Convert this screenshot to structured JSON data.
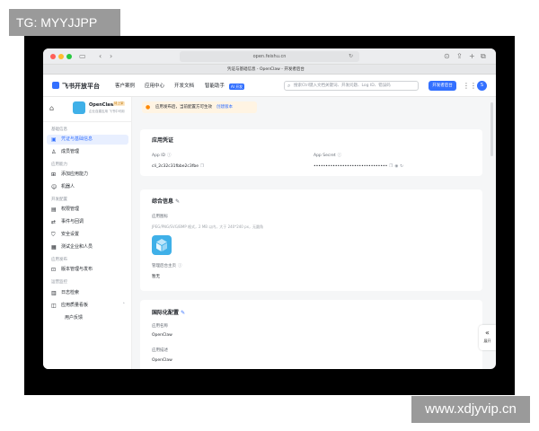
{
  "watermark_top": "TG: MYYJJPP",
  "watermark_bottom": "www.xdjyvip.cn",
  "browser": {
    "url": "open.feishu.cn",
    "tab_title": "凭证与基础信息 - OpenClaw - 开发者后台"
  },
  "nav": {
    "logo": "飞书开放平台",
    "items": [
      "客户案例",
      "应用中心",
      "开发文档",
      "智能助手"
    ],
    "ai_tag": "AI 开发",
    "search_placeholder": "搜索Ctrl键入文档关键词、开发问题、Log ID、错误码",
    "dev_console": "开发者后台",
    "avatar": "S"
  },
  "app": {
    "name": "OpenClaw",
    "tag": "待上架",
    "desc": "企业自建应用 飞书中可用"
  },
  "sidebar": {
    "sections": [
      {
        "title": "基础信息",
        "items": [
          "凭证与基础信息",
          "成员管理"
        ]
      },
      {
        "title": "应用能力",
        "items": [
          "添加应用能力",
          "机器人"
        ]
      },
      {
        "title": "开发配置",
        "items": [
          "权限管理",
          "事件与回调",
          "安全设置",
          "测试企业和人员"
        ]
      },
      {
        "title": "应用发布",
        "items": [
          "版本管理与发布"
        ]
      },
      {
        "title": "运营监控",
        "items": [
          "日志检索",
          "应用质量看板",
          "用户反馈"
        ]
      }
    ]
  },
  "banner": {
    "text": "应用发布后，当前配置方可生效",
    "link": "创建版本"
  },
  "credentials": {
    "title": "应用凭证",
    "app_id_label": "App ID",
    "app_id": "cli_2c32c31fbbe2c3fbe",
    "secret_label": "App Secret",
    "secret": "•••••••••••••••••••••••••••••••"
  },
  "general": {
    "title": "综合信息",
    "icon_label": "应用图标",
    "icon_hint": "JPEG/PNG/SVG/BMP 格式，2 MB 以内，大于 240*240 px，无圆角",
    "homepage_label": "管理后台主页",
    "homepage_value": "暂无"
  },
  "i18n": {
    "title": "国际化配置",
    "name_label": "应用名称",
    "name_value": "OpenClaw",
    "desc_label": "应用描述",
    "desc_value": "OpenClaw"
  },
  "fold": {
    "arrow": "«",
    "label": "展开"
  },
  "colors": {
    "accent": "#3370ff",
    "app_icon": "#3fb0e8",
    "banner": "#fff4e3"
  }
}
